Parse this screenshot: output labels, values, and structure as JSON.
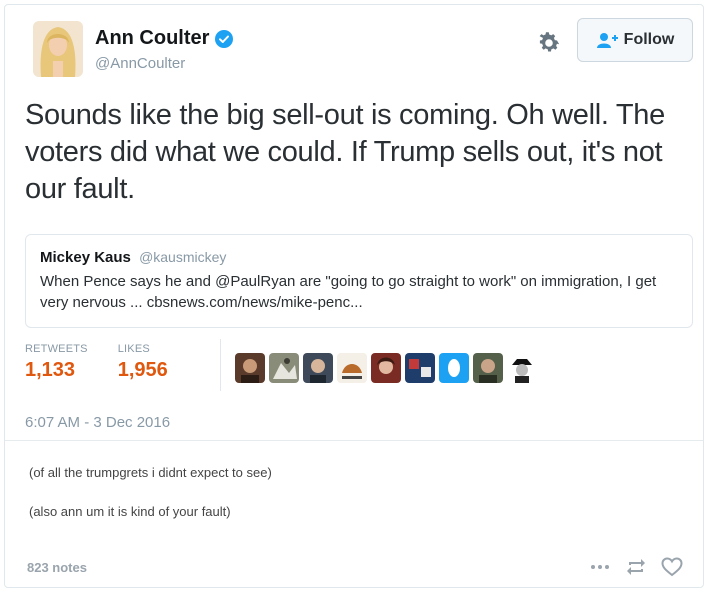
{
  "tweet": {
    "author_name": "Ann Coulter",
    "author_handle": "@AnnCoulter",
    "follow_label": "Follow",
    "text": "Sounds like the big sell-out is coming.  Oh well. The voters did what we could.  If Trump sells out, it's not our fault.",
    "quoted": {
      "name": "Mickey Kaus",
      "handle": "@kausmickey",
      "text": "When Pence says he and @PaulRyan are \"going to go straight to work\" on immigration, I get very nervous ... cbsnews.com/news/mike-penc..."
    },
    "stats": {
      "retweets_label": "RETWEETS",
      "retweets_value": "1,133",
      "likes_label": "LIKES",
      "likes_value": "1,956"
    },
    "timestamp": "6:07 AM - 3 Dec 2016",
    "colors": {
      "verified": "#1da1f2",
      "stat_value": "#e0570e",
      "muted": "#8899a6"
    }
  },
  "post": {
    "caption_1": "(of all the trumpgrets i didnt expect to see)",
    "caption_2": "(also ann um it is kind of your fault)",
    "notes": "823 notes",
    "icons": [
      "more-icon",
      "reblog-icon",
      "heart-icon"
    ]
  }
}
